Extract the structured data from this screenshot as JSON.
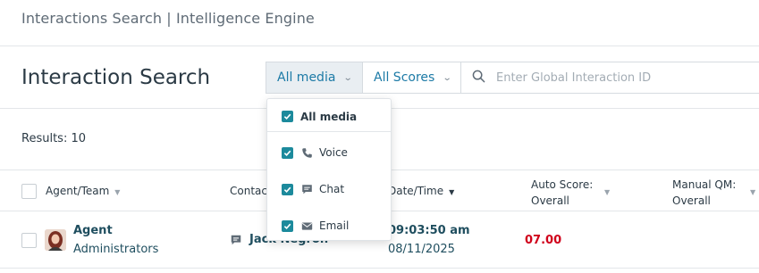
{
  "topbar": {
    "breadcrumb": "Interactions Search | Intelligence Engine"
  },
  "header": {
    "title": "Interaction Search"
  },
  "filters": {
    "media_label": "All media",
    "scores_label": "All Scores",
    "search_placeholder": "Enter Global Interaction ID"
  },
  "media_dropdown": {
    "items": [
      {
        "label": "All media",
        "checked": true,
        "icon": "none"
      },
      {
        "label": "Voice",
        "checked": true,
        "icon": "phone-icon"
      },
      {
        "label": "Chat",
        "checked": true,
        "icon": "chat-icon"
      },
      {
        "label": "Email",
        "checked": true,
        "icon": "email-icon"
      }
    ]
  },
  "results": {
    "text": "Results: 10"
  },
  "table": {
    "columns": [
      {
        "line1": "Agent/Team",
        "line2": ""
      },
      {
        "line1": "Contact",
        "line2": ""
      },
      {
        "line1": "Date/Time",
        "line2": ""
      },
      {
        "line1": "Auto Score:",
        "line2": "Overall"
      },
      {
        "line1": "Manual QM:",
        "line2": "Overall"
      }
    ],
    "rows": [
      {
        "agent": "Agent",
        "team": "Administrators",
        "contact": "Jack Negron",
        "time": "09:03:50 am",
        "date": "08/11/2025",
        "auto_score": "07.00",
        "manual_score": ""
      }
    ]
  },
  "colors": {
    "accent": "#1c7aa6",
    "check": "#1c8a9c",
    "score_red": "#d0021b"
  }
}
